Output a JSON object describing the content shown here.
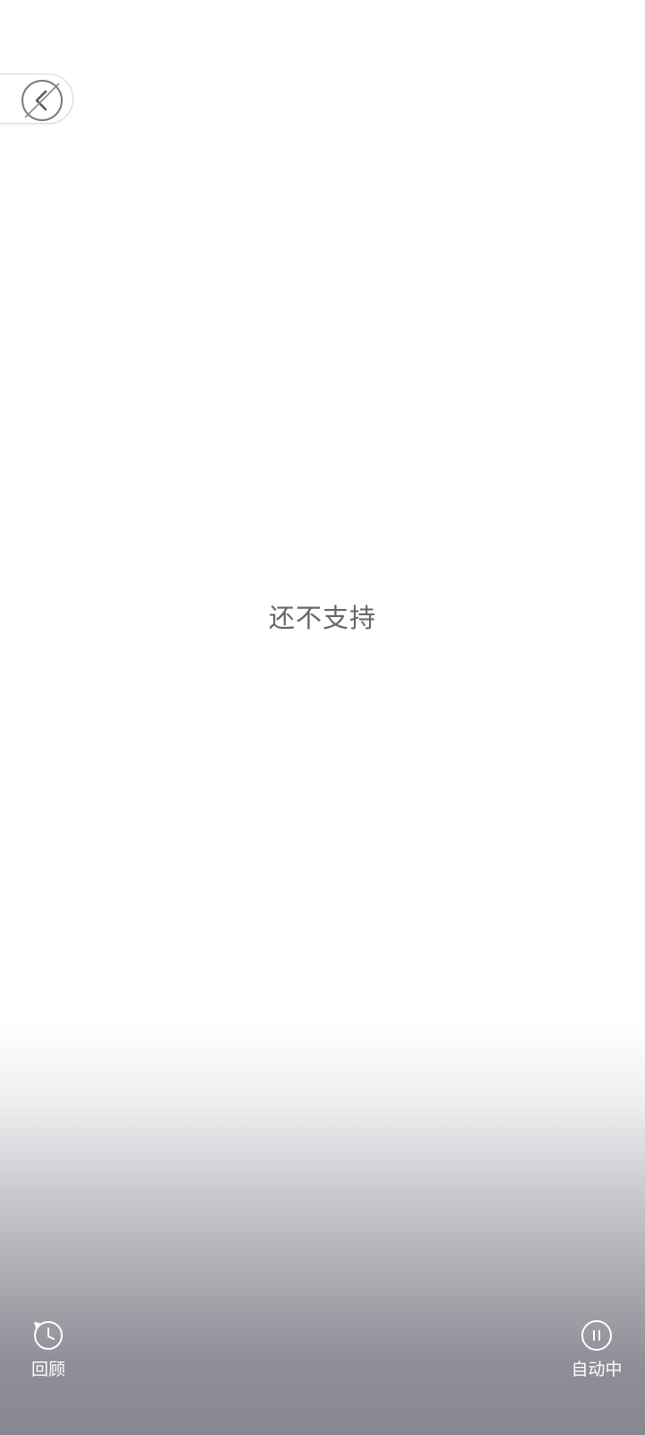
{
  "main": {
    "message": "还不支持"
  },
  "bottom_bar": {
    "review_label": "回顾",
    "auto_label": "自动中"
  },
  "icons": {
    "back": "back-chevron-icon",
    "review": "history-clock-icon",
    "auto": "pause-circle-icon"
  },
  "colors": {
    "message_text": "#666666",
    "bottom_gradient_end": "#868791",
    "bottom_label": "#ffffff"
  }
}
